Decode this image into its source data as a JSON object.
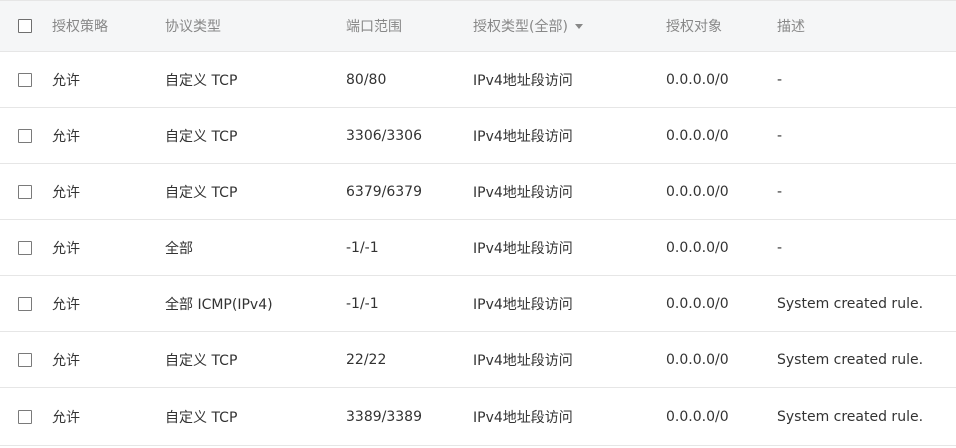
{
  "table": {
    "headers": {
      "policy": "授权策略",
      "protocol": "协议类型",
      "port": "端口范围",
      "auth_type": "授权类型(全部)",
      "target": "授权对象",
      "description": "描述"
    },
    "rows": [
      {
        "policy": "允许",
        "protocol": "自定义 TCP",
        "port": "80/80",
        "auth_type": "IPv4地址段访问",
        "target": "0.0.0.0/0",
        "description": "-"
      },
      {
        "policy": "允许",
        "protocol": "自定义 TCP",
        "port": "3306/3306",
        "auth_type": "IPv4地址段访问",
        "target": "0.0.0.0/0",
        "description": "-"
      },
      {
        "policy": "允许",
        "protocol": "自定义 TCP",
        "port": "6379/6379",
        "auth_type": "IPv4地址段访问",
        "target": "0.0.0.0/0",
        "description": "-"
      },
      {
        "policy": "允许",
        "protocol": "全部",
        "port": "-1/-1",
        "auth_type": "IPv4地址段访问",
        "target": "0.0.0.0/0",
        "description": "-"
      },
      {
        "policy": "允许",
        "protocol": "全部 ICMP(IPv4)",
        "port": "-1/-1",
        "auth_type": "IPv4地址段访问",
        "target": "0.0.0.0/0",
        "description": "System created rule."
      },
      {
        "policy": "允许",
        "protocol": "自定义 TCP",
        "port": "22/22",
        "auth_type": "IPv4地址段访问",
        "target": "0.0.0.0/0",
        "description": "System created rule."
      },
      {
        "policy": "允许",
        "protocol": "自定义 TCP",
        "port": "3389/3389",
        "auth_type": "IPv4地址段访问",
        "target": "0.0.0.0/0",
        "description": "System created rule."
      }
    ]
  }
}
